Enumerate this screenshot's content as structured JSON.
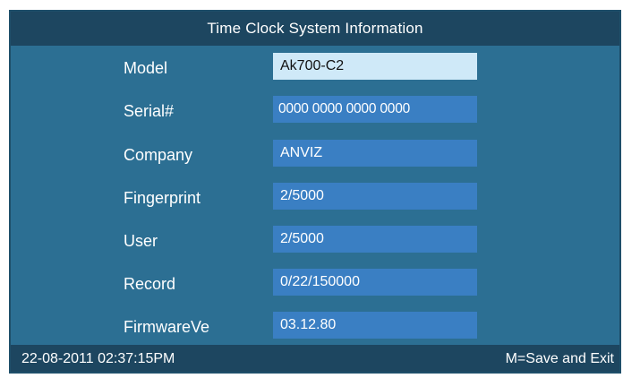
{
  "window": {
    "title": "Time Clock System Information"
  },
  "fields": [
    {
      "label": "Model",
      "value": "Ak700-C2",
      "selected": true
    },
    {
      "label": "Serial#",
      "value": "0000 0000 0000 0000",
      "selected": false
    },
    {
      "label": "Company",
      "value": "ANVIZ",
      "selected": false
    },
    {
      "label": "Fingerprint",
      "value": "2/5000",
      "selected": false
    },
    {
      "label": "User",
      "value": "2/5000",
      "selected": false
    },
    {
      "label": "Record",
      "value": "0/22/150000",
      "selected": false
    },
    {
      "label": "FirmwareVe",
      "value": "03.12.80",
      "selected": false
    }
  ],
  "status_bar": {
    "datetime": "22-08-2011  02:37:15PM",
    "hint": "M=Save and Exit"
  },
  "colors": {
    "panel_background": "#2c6f93",
    "bar_background": "#1d4660",
    "value_background": "#3a7fc3",
    "selected_value_background": "#cfe9f8"
  }
}
